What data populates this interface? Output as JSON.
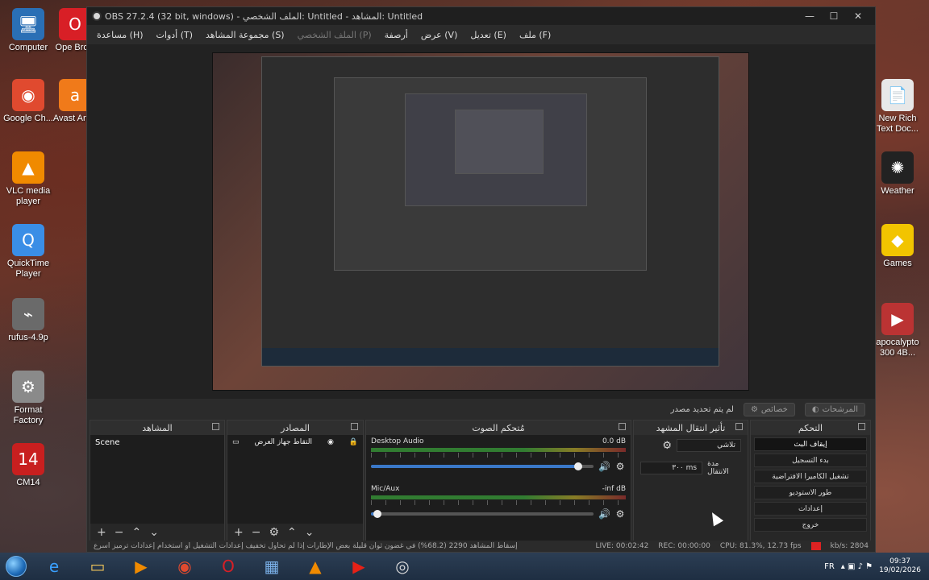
{
  "desktop": {
    "icons_left": [
      {
        "label": "Computer",
        "icon": "computer-icon",
        "glyph": "🖥",
        "color": "#2a6fb5"
      },
      {
        "label": "Google Ch...",
        "icon": "chrome-icon",
        "glyph": "◉",
        "color": "#e04a2f"
      },
      {
        "label": "VLC media player",
        "icon": "vlc-icon",
        "glyph": "▲",
        "color": "#f08a00"
      },
      {
        "label": "QuickTime Player",
        "icon": "quicktime-icon",
        "glyph": "Q",
        "color": "#3a8ee6"
      },
      {
        "label": "rufus-4.9p",
        "icon": "usb-icon",
        "glyph": "⌁",
        "color": "#6a6a6a"
      },
      {
        "label": "Format Factory",
        "icon": "format-factory-icon",
        "glyph": "⚙",
        "color": "#8a8a8a"
      },
      {
        "label": "CM14",
        "icon": "cm14-icon",
        "glyph": "14",
        "color": "#c81f1f"
      }
    ],
    "icons_left2": [
      {
        "label": "Ope Brow",
        "icon": "opera-icon",
        "glyph": "O",
        "color": "#d81f26"
      },
      {
        "label": "Avast Antiv",
        "icon": "avast-icon",
        "glyph": "a",
        "color": "#f07a1a"
      }
    ],
    "icons_right": [
      {
        "label": "New Rich Text Doc...",
        "icon": "document-icon",
        "glyph": "📄",
        "color": "#e8e8e8"
      },
      {
        "label": "Weather",
        "icon": "weather-icon",
        "glyph": "✺",
        "color": "#222"
      },
      {
        "label": "Games",
        "icon": "games-icon",
        "glyph": "◆",
        "color": "#f2c400"
      },
      {
        "label": "apocalypto 300 4B...",
        "icon": "video-file-icon",
        "glyph": "▶",
        "color": "#b33"
      }
    ]
  },
  "window": {
    "title": "OBS 27.2.4 (32 bit, windows) - الملف الشخصي: Untitled - المشاهد: Untitled",
    "menu": [
      {
        "label": "ملف (F)",
        "disabled": false
      },
      {
        "label": "تعديل (E)",
        "disabled": false
      },
      {
        "label": "عرض (V)",
        "disabled": false
      },
      {
        "label": "أرصفة",
        "disabled": false
      },
      {
        "label": "الملف الشخصي (P)",
        "disabled": true
      },
      {
        "label": "مجموعة المشاهد (S)",
        "disabled": false
      },
      {
        "label": "أدوات (T)",
        "disabled": false
      },
      {
        "label": "مساعدة (H)",
        "disabled": false
      }
    ]
  },
  "status_line": {
    "no_source": "لم يتم تحديد مصدر",
    "properties": "خصائص",
    "filters": "المرشحات"
  },
  "docks": {
    "scenes": {
      "title": "المشاهد",
      "items": [
        "Scene"
      ]
    },
    "sources": {
      "title": "المصادر",
      "items": [
        "التقاط جهاز العرض"
      ]
    },
    "mixer": {
      "title": "مُتحكم الصوت",
      "tracks": [
        {
          "name": "Desktop Audio",
          "db": "0.0 dB",
          "volume": 0.93,
          "muted": false
        },
        {
          "name": "Mic/Aux",
          "db": "-inf dB",
          "volume": 0.03,
          "muted": true
        }
      ]
    },
    "transitions": {
      "title": "تأثير انتقال المشهد",
      "type": "تلاشي",
      "duration_label": "مدة الانتقال",
      "duration_value": "٣٠٠ ms"
    },
    "controls": {
      "title": "التحكم",
      "buttons": [
        "إيقاف البث",
        "بدء التسجيل",
        "تشغيل الكاميرا الافتراضية",
        "طور الاستوديو",
        "إعدادات",
        "خروج"
      ]
    }
  },
  "statusbar": {
    "dropped": "إسقاط المشاهد 2290 (68.2%) في غضون ثوان قليلة بعض الإطارات إذا لم تحاول تخفيف إعدادات التشغيل أو استخدام إعدادات ترميز أسرع",
    "live": "LIVE: 00:02:42",
    "rec": "REC: 00:00:00",
    "cpu": "CPU: 81.3%, 12.73 fps",
    "kbps": "kb/s: 2804"
  },
  "taskbar": {
    "items": [
      {
        "icon": "ie-icon",
        "glyph": "e",
        "color": "#3aa0ff"
      },
      {
        "icon": "file-explorer-icon",
        "glyph": "▭",
        "color": "#f1c55a"
      },
      {
        "icon": "media-player-icon",
        "glyph": "▶",
        "color": "#f08a00"
      },
      {
        "icon": "chrome-icon",
        "glyph": "◉",
        "color": "#e04a2f"
      },
      {
        "icon": "opera-icon",
        "glyph": "O",
        "color": "#d81f26"
      },
      {
        "icon": "network-icon",
        "glyph": "▦",
        "color": "#7ab0e8"
      },
      {
        "icon": "vlc-icon",
        "glyph": "▲",
        "color": "#f08a00"
      },
      {
        "icon": "youtube-icon",
        "glyph": "▶",
        "color": "#e62117"
      },
      {
        "icon": "obs-icon",
        "glyph": "◎",
        "color": "#ddd"
      }
    ],
    "lang": "FR",
    "time": "09:37",
    "date": "19/02/2026"
  }
}
